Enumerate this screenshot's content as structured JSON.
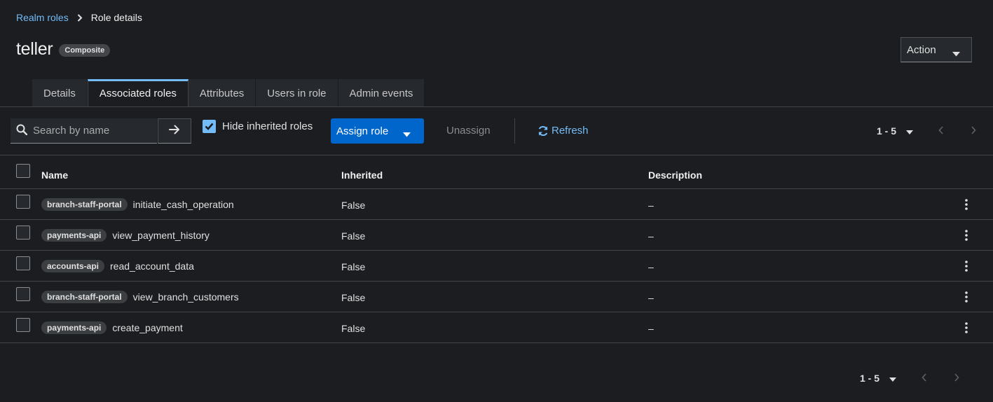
{
  "breadcrumb": {
    "parent": "Realm roles",
    "current": "Role details"
  },
  "header": {
    "title": "teller",
    "badge": "Composite",
    "action_label": "Action"
  },
  "tabs": [
    {
      "label": "Details"
    },
    {
      "label": "Associated roles"
    },
    {
      "label": "Attributes"
    },
    {
      "label": "Users in role"
    },
    {
      "label": "Admin events"
    }
  ],
  "toolbar": {
    "search_placeholder": "Search by name",
    "hide_inherited_label": "Hide inherited roles",
    "hide_inherited_checked": true,
    "assign_label": "Assign role",
    "unassign_label": "Unassign",
    "refresh_label": "Refresh",
    "pagination": "1 - 5"
  },
  "table": {
    "columns": [
      "Name",
      "Inherited",
      "Description"
    ],
    "rows": [
      {
        "client": "branch-staff-portal",
        "role": "initiate_cash_operation",
        "inherited": "False",
        "description": "–"
      },
      {
        "client": "payments-api",
        "role": "view_payment_history",
        "inherited": "False",
        "description": "–"
      },
      {
        "client": "accounts-api",
        "role": "read_account_data",
        "inherited": "False",
        "description": "–"
      },
      {
        "client": "branch-staff-portal",
        "role": "view_branch_customers",
        "inherited": "False",
        "description": "–"
      },
      {
        "client": "payments-api",
        "role": "create_payment",
        "inherited": "False",
        "description": "–"
      }
    ]
  },
  "footer": {
    "pagination": "1 - 5"
  },
  "colors": {
    "accent": "#73bcf7",
    "primary_button": "#0066cc",
    "background": "#1b1d21"
  },
  "icons": [
    "chevron-right-icon",
    "caret-down-icon",
    "search-icon",
    "arrow-right-icon",
    "checkmark-icon",
    "sync-icon",
    "angle-left-icon",
    "angle-right-icon",
    "kebab-icon"
  ]
}
